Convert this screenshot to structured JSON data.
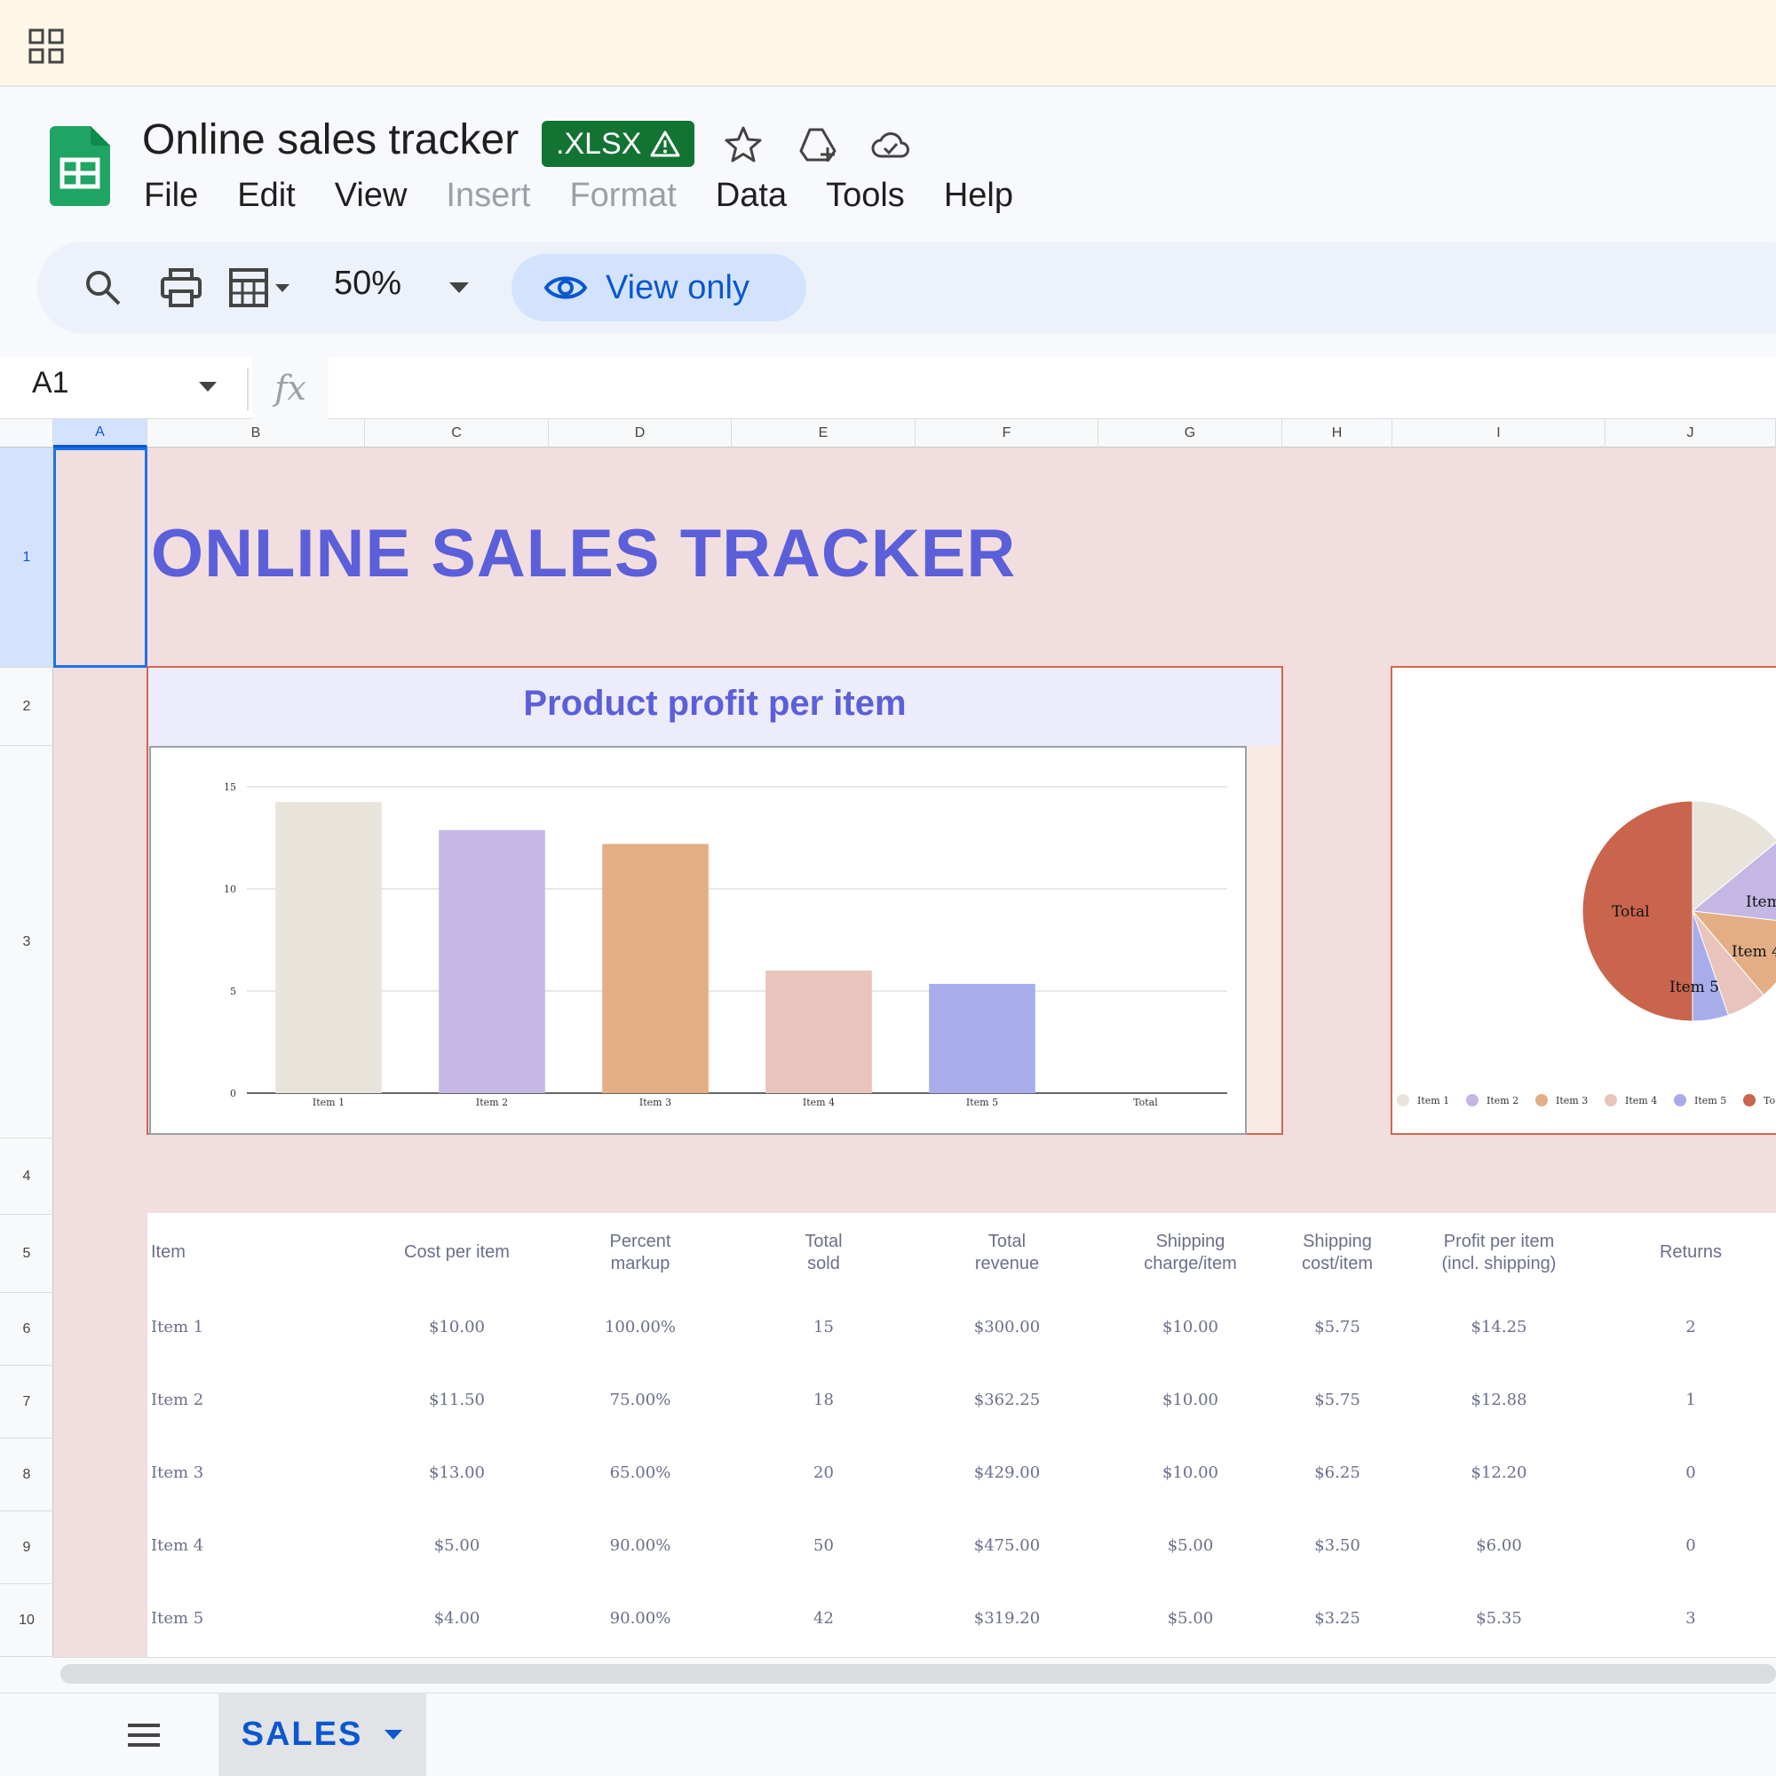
{
  "header": {
    "title": "Online sales tracker",
    "badge": ".XLSX",
    "menus": [
      "File",
      "Edit",
      "View",
      "Insert",
      "Format",
      "Data",
      "Tools",
      "Help"
    ],
    "disabled_menus": [
      "Insert",
      "Format"
    ]
  },
  "toolbar": {
    "zoom": "50%",
    "view_only": "View only"
  },
  "formula": {
    "cell_ref": "A1",
    "fx": "fx",
    "value": ""
  },
  "columns": [
    "A",
    "B",
    "C",
    "D",
    "E",
    "F",
    "G",
    "H",
    "I",
    "J"
  ],
  "rows": [
    "1",
    "2",
    "3",
    "4",
    "5",
    "6",
    "7",
    "8",
    "9",
    "10"
  ],
  "sheet": {
    "title": "ONLINE SALES TRACKER",
    "bar_chart_title": "Product profit per item",
    "table_headers": [
      [
        "Item"
      ],
      [
        "Cost per item"
      ],
      [
        "Percent",
        "markup"
      ],
      [
        "Total",
        "sold"
      ],
      [
        "Total",
        "revenue"
      ],
      [
        "Shipping",
        "charge/item"
      ],
      [
        "Shipping",
        "cost/item"
      ],
      [
        "Profit per item",
        "(incl. shipping)"
      ],
      [
        "Returns"
      ]
    ],
    "table_rows": [
      [
        "Item 1",
        "$10.00",
        "100.00%",
        "15",
        "$300.00",
        "$10.00",
        "$5.75",
        "$14.25",
        "2"
      ],
      [
        "Item 2",
        "$11.50",
        "75.00%",
        "18",
        "$362.25",
        "$10.00",
        "$5.75",
        "$12.88",
        "1"
      ],
      [
        "Item 3",
        "$13.00",
        "65.00%",
        "20",
        "$429.00",
        "$10.00",
        "$6.25",
        "$12.20",
        "0"
      ],
      [
        "Item 4",
        "$5.00",
        "90.00%",
        "50",
        "$475.00",
        "$5.00",
        "$3.50",
        "$6.00",
        "0"
      ],
      [
        "Item 5",
        "$4.00",
        "90.00%",
        "42",
        "$319.20",
        "$5.00",
        "$3.25",
        "$5.35",
        "3"
      ]
    ]
  },
  "chart_data": [
    {
      "type": "bar",
      "title": "Product profit per item",
      "categories": [
        "Item 1",
        "Item 2",
        "Item 3",
        "Item 4",
        "Item 5",
        "Total"
      ],
      "values": [
        14.25,
        12.88,
        12.2,
        6.0,
        5.35,
        0
      ],
      "colors": [
        "#e8e4dc",
        "#c5b7e3",
        "#e3ae84",
        "#e8c4bd",
        "#a9aceb",
        "#c9654d"
      ],
      "yticks": [
        0,
        5,
        10,
        15
      ],
      "ylim": [
        0,
        15
      ]
    },
    {
      "type": "pie",
      "categories": [
        "Item 1",
        "Item 2",
        "Item 3",
        "Item 4",
        "Item 5",
        "Total"
      ],
      "values": [
        14.25,
        12.88,
        12.2,
        6.0,
        5.35,
        50.68
      ],
      "colors": [
        "#e8e4dc",
        "#c5b7e3",
        "#e3ae84",
        "#e8c4bd",
        "#a9aceb",
        "#c9654d"
      ],
      "legend_labels": [
        "Item 1",
        "Item 2",
        "Item 3",
        "Item 4",
        "Item 5",
        "To"
      ],
      "slice_labels": [
        "Total",
        "Item",
        "Item 4",
        "Item 5"
      ]
    }
  ],
  "sheet_tabs": [
    {
      "label": "SALES"
    }
  ],
  "colors": {
    "accent": "#5b5fd9",
    "badge": "#137333",
    "view_only_bg": "#d3e3fd",
    "sheet_bg": "#f2dede"
  }
}
